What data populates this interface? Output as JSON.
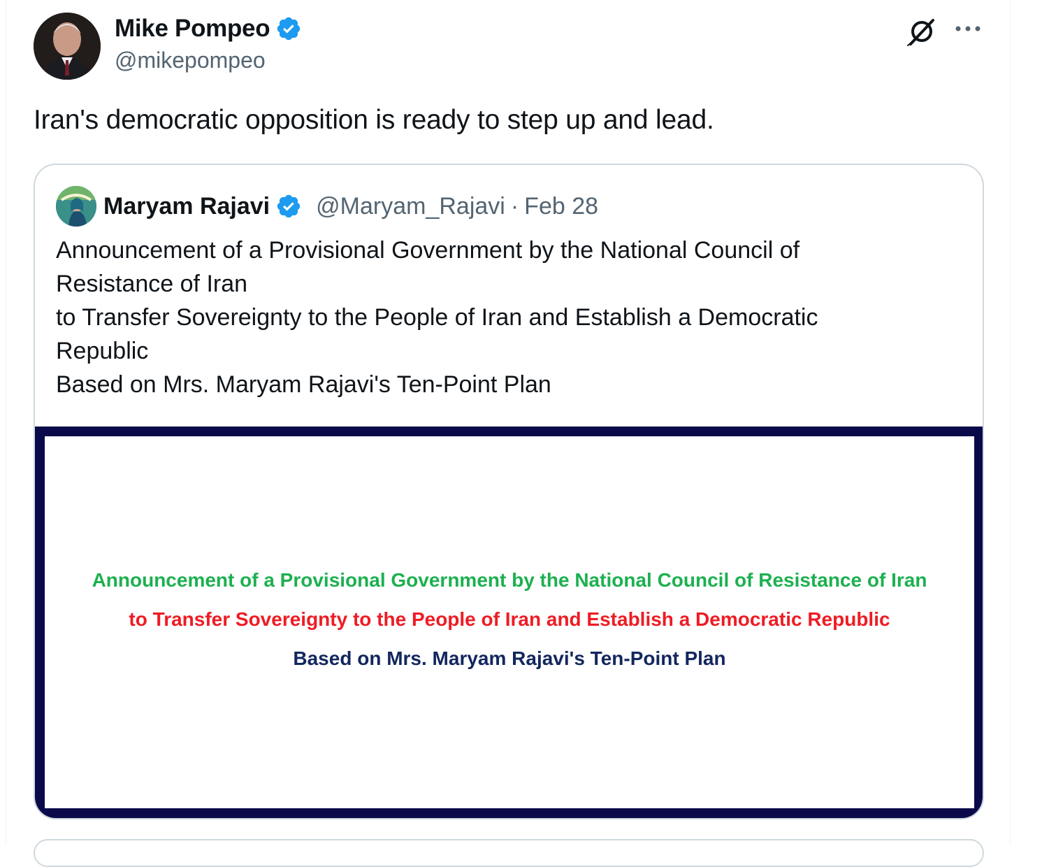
{
  "post": {
    "author": {
      "display_name": "Mike Pompeo",
      "handle": "@mikepompeo",
      "verified": true
    },
    "text": "Iran's democratic opposition is ready to step up and lead.",
    "actions": {
      "grok_icon": "grok-icon",
      "more_icon": "more-options-icon"
    }
  },
  "quoted_post": {
    "author": {
      "display_name": "Maryam Rajavi",
      "handle": "@Maryam_Rajavi",
      "verified": true
    },
    "separator": "·",
    "date": "Feb 28",
    "text_lines": [
      "Announcement of a Provisional Government by the National Council of",
      "Resistance of Iran",
      "to Transfer Sovereignty to the People of Iran and Establish a Democratic",
      "Republic",
      "Based on Mrs. Maryam Rajavi's Ten-Point Plan"
    ],
    "media": {
      "line1": "Announcement of a Provisional Government by the National Council of Resistance of Iran",
      "line2": "to Transfer Sovereignty to the People of Iran and Establish a Democratic Republic",
      "line3": "Based on Mrs. Maryam Rajavi's Ten-Point Plan"
    }
  },
  "colors": {
    "verified_blue": "#1d9bf0",
    "secondary_text": "#536471",
    "border": "#cfd9de",
    "media_frame": "#0a0a4a",
    "media_green": "#1db050",
    "media_red": "#ee1c24",
    "media_navy": "#13275e"
  }
}
